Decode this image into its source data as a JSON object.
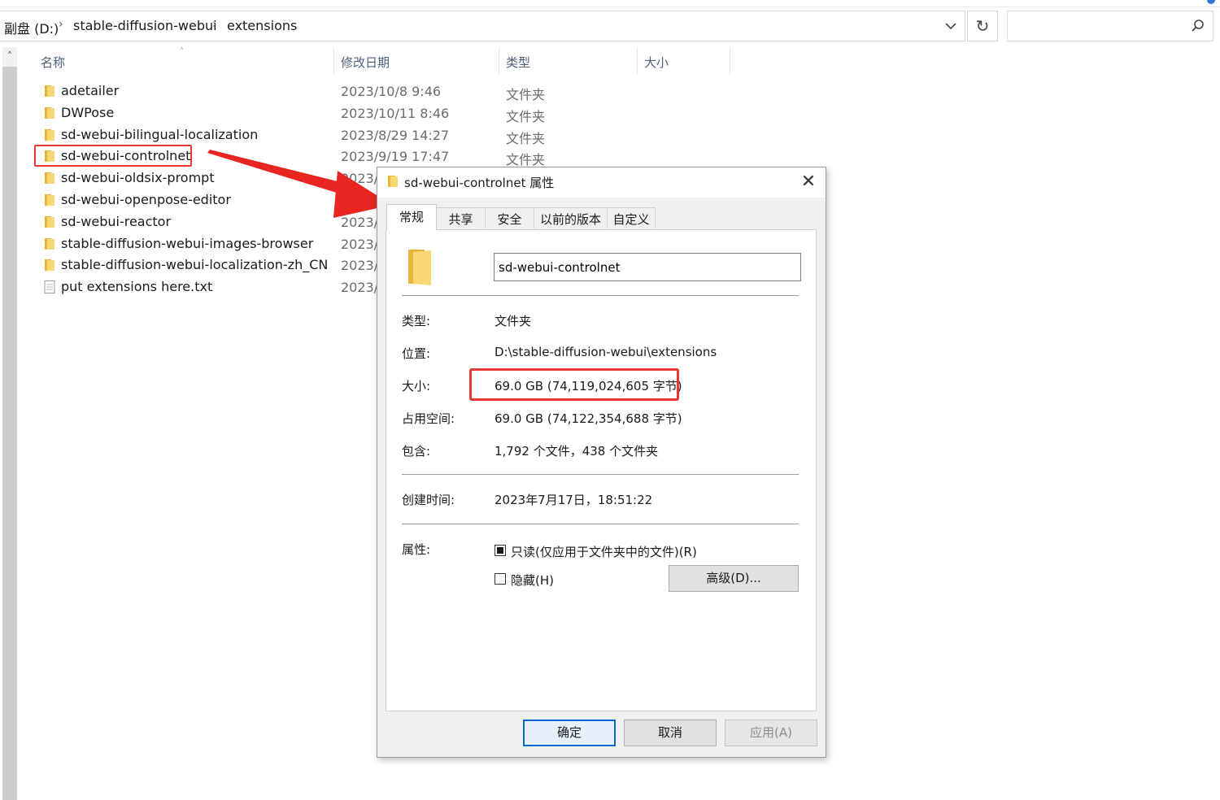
{
  "explorer": {
    "breadcrumb": [
      {
        "label": "副盘 (D:)"
      },
      {
        "label": "stable-diffusion-webui"
      },
      {
        "label": "extensions"
      }
    ],
    "refresh_glyph": "↻",
    "columns": {
      "name": "名称",
      "date": "修改日期",
      "type": "类型",
      "size": "大小"
    },
    "files": [
      {
        "name": "adetailer",
        "date": "2023/10/8 9:46",
        "type": "文件夹",
        "icon": "folder-icon"
      },
      {
        "name": "DWPose",
        "date": "2023/10/11 8:46",
        "type": "文件夹",
        "icon": "folder-icon"
      },
      {
        "name": "sd-webui-bilingual-localization",
        "date": "2023/8/29 14:27",
        "type": "文件夹",
        "icon": "folder-icon"
      },
      {
        "name": "sd-webui-controlnet",
        "date": "2023/9/19 17:47",
        "type": "文件夹",
        "icon": "folder-icon"
      },
      {
        "name": "sd-webui-oldsix-prompt",
        "date": "2023/",
        "type": "",
        "icon": "folder-icon"
      },
      {
        "name": "sd-webui-openpose-editor",
        "date": "2023/",
        "type": "",
        "icon": "folder-icon"
      },
      {
        "name": "sd-webui-reactor",
        "date": "2023/",
        "type": "",
        "icon": "folder-icon"
      },
      {
        "name": "stable-diffusion-webui-images-browser",
        "date": "2023/",
        "type": "",
        "icon": "folder-icon"
      },
      {
        "name": "stable-diffusion-webui-localization-zh_CN",
        "date": "2023/",
        "type": "",
        "icon": "folder-icon"
      },
      {
        "name": "put extensions here.txt",
        "date": "2023/",
        "type": "",
        "icon": "text-file-icon"
      }
    ]
  },
  "dialog": {
    "title": "sd-webui-controlnet 属性",
    "close_glyph": "✕",
    "tabs": [
      {
        "label": "常规",
        "active": true
      },
      {
        "label": "共享"
      },
      {
        "label": "安全"
      },
      {
        "label": "以前的版本"
      },
      {
        "label": "自定义"
      }
    ],
    "folder_name": "sd-webui-controlnet",
    "props": {
      "type_label": "类型:",
      "type_value": "文件夹",
      "location_label": "位置:",
      "location_value": "D:\\stable-diffusion-webui\\extensions",
      "size_label": "大小:",
      "size_value": "69.0 GB (74,119,024,605 字节)",
      "disk_label": "占用空间:",
      "disk_value": "69.0 GB (74,122,354,688 字节)",
      "contains_label": "包含:",
      "contains_value": "1,792 个文件，438 个文件夹",
      "created_label": "创建时间:",
      "created_value": "2023年7月17日，18:51:22",
      "attributes_label": "属性:"
    },
    "attributes": {
      "readonly_label": "只读(仅应用于文件夹中的文件)(R)",
      "readonly_state": "indeterminate",
      "hidden_label": "隐藏(H)",
      "hidden_checked": false,
      "advanced_button": "高级(D)..."
    },
    "buttons": {
      "ok": "确定",
      "cancel": "取消",
      "apply": "应用(A)"
    }
  },
  "colors": {
    "highlight_red": "#e53935",
    "folder_yellow": "#f8d775",
    "primary_blue": "#0a64d2"
  }
}
